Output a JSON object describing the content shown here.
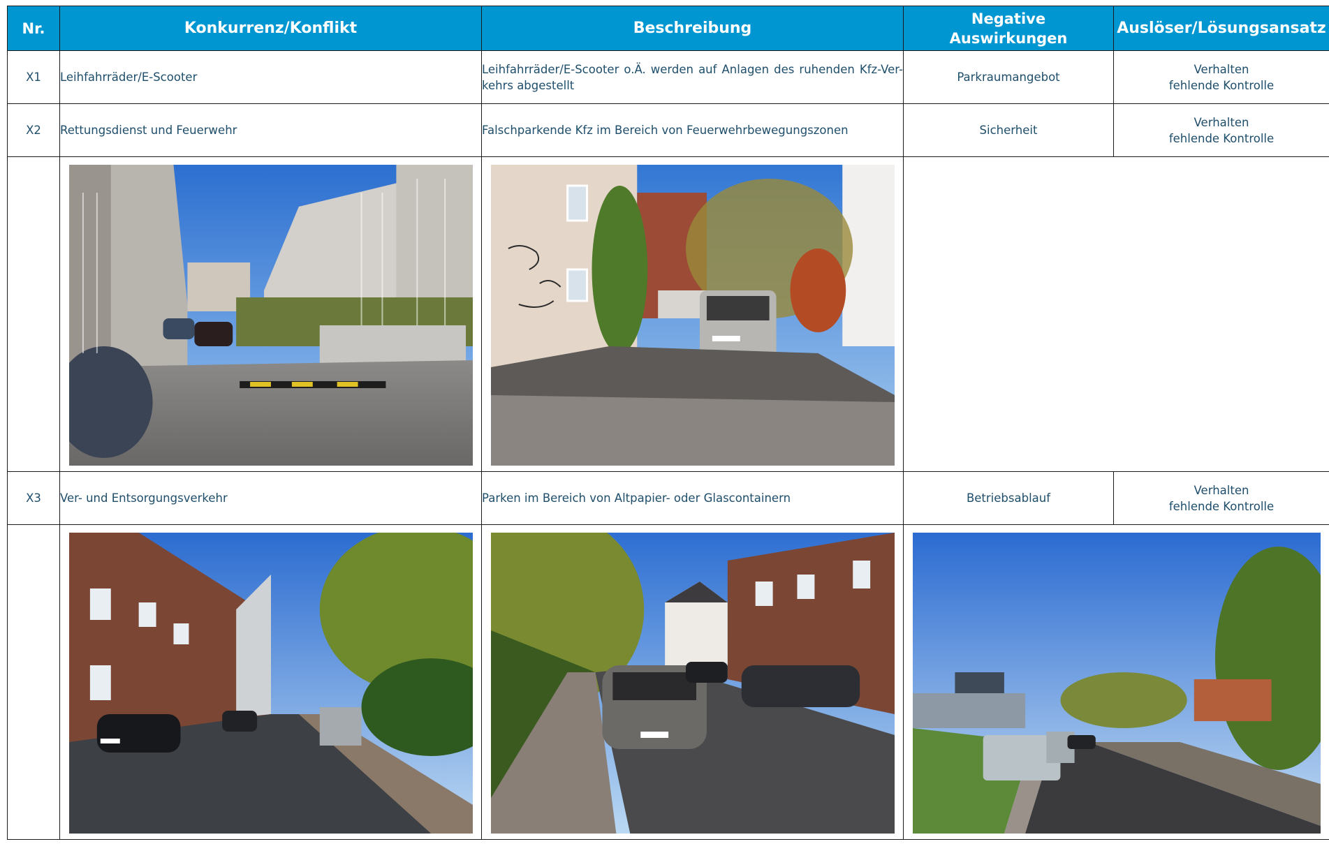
{
  "header": {
    "nr": "Nr.",
    "konkurrenz": "Konkurrenz/Konflikt",
    "beschreibung": "Beschreibung",
    "negative_line1": "Negative",
    "negative_line2": "Auswirkungen",
    "ausloeser": "Auslöser/Lösungsansatz"
  },
  "rows": [
    {
      "nr": "X1",
      "konkurrenz": "Leihfahrräder/E-Scooter",
      "beschreibung": "Leihfahrräder/E-Scooter o.Ä. werden auf Anlagen des ruhenden Kfz-Ver- kehrs abgestellt",
      "negative": "Parkraumangebot",
      "ausloeser_line1": "Verhalten",
      "ausloeser_line2": "fehlende Kontrolle"
    },
    {
      "nr": "X2",
      "konkurrenz": "Rettungsdienst und Feuerwehr",
      "beschreibung": "Falschparkende Kfz im Bereich von Feuerwehrbewegungszonen",
      "negative": "Sicherheit",
      "ausloeser_line1": "Verhalten",
      "ausloeser_line2": "fehlende Kontrolle"
    },
    {
      "nr": "X3",
      "konkurrenz": "Ver- und Entsorgungsverkehr",
      "beschreibung": "Parken im Bereich von Altpapier- oder Glascontainern",
      "negative": "Betriebsablauf",
      "ausloeser_line1": "Verhalten",
      "ausloeser_line2": "fehlende Kontrolle"
    }
  ],
  "colors": {
    "header_bg": "#0096d1",
    "header_text": "#ffffff",
    "body_text": "#1f4e6b",
    "border": "#1a1a1a"
  }
}
